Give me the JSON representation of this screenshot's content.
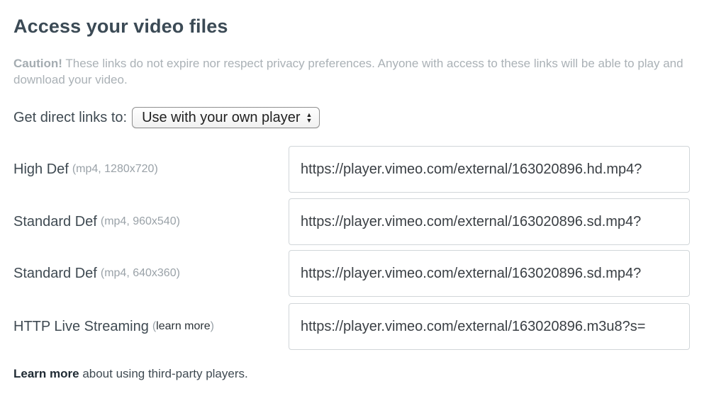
{
  "title": "Access your video files",
  "caution": {
    "label": "Caution!",
    "text": " These links do not expire nor respect privacy preferences. Anyone with access to these links will be able to play and download your video."
  },
  "direct_links": {
    "label": "Get direct links to:",
    "selected": "Use with your own player"
  },
  "rows": [
    {
      "label": "High Def",
      "meta": "(mp4, 1280x720)",
      "url": "https://player.vimeo.com/external/163020896.hd.mp4?"
    },
    {
      "label": "Standard Def",
      "meta": "(mp4, 960x540)",
      "url": "https://player.vimeo.com/external/163020896.sd.mp4?"
    },
    {
      "label": "Standard Def",
      "meta": "(mp4, 640x360)",
      "url": "https://player.vimeo.com/external/163020896.sd.mp4?"
    },
    {
      "label": "HTTP Live Streaming",
      "meta_open": "(",
      "meta_link": "learn more",
      "meta_close": ")",
      "url": "https://player.vimeo.com/external/163020896.m3u8?s="
    }
  ],
  "footer": {
    "link": "Learn more",
    "text": " about using third-party players."
  }
}
